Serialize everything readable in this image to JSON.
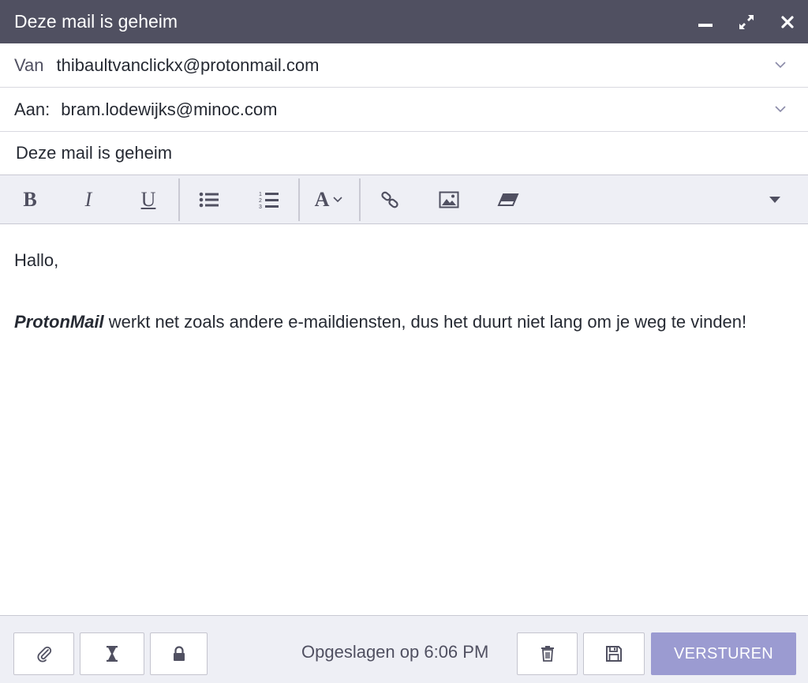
{
  "window": {
    "title": "Deze mail is geheim",
    "controls": {
      "minimize": "minimize-icon",
      "expand": "expand-icon",
      "close": "close-icon"
    }
  },
  "from": {
    "label": "Van",
    "value": "thibaultvanclickx@protonmail.com"
  },
  "to": {
    "label": "Aan:",
    "value": "bram.lodewijks@minoc.com"
  },
  "subject": {
    "value": "Deze mail is geheim"
  },
  "toolbar": {
    "bold": "B",
    "italic": "I",
    "underline": "U",
    "font": "A",
    "icons": [
      "bold-icon",
      "italic-icon",
      "underline-icon",
      "bullet-list-icon",
      "numbered-list-icon",
      "font-icon",
      "link-icon",
      "image-icon",
      "eraser-icon",
      "more-dropdown-icon"
    ]
  },
  "message": {
    "greeting": "Hallo,",
    "brand": "ProtonMail",
    "text": " werkt net zoals andere e-maildiensten, dus het duurt niet lang om je weg te vinden!"
  },
  "footer": {
    "status": "Opgeslagen op 6:06 PM",
    "send_label": "VERSTUREN",
    "icons": [
      "paperclip-icon",
      "hourglass-icon",
      "lock-icon",
      "trash-icon",
      "save-icon"
    ]
  },
  "colors": {
    "titlebar": "#505061",
    "toolbar_bg": "#eeeff5",
    "send_button": "#9b9bd1",
    "text": "#262a33"
  }
}
